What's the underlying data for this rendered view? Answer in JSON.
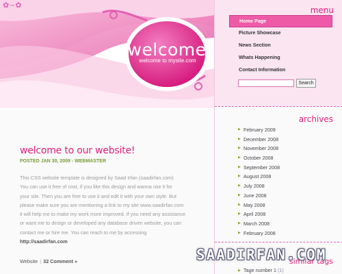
{
  "header": {
    "welcome_title": "welcome",
    "welcome_subtitle": "welcome to mysite.com"
  },
  "post": {
    "title": "welcome to our website!",
    "meta": "POSTED JAN 30, 2009 - WEBMASTER",
    "body_lines": [
      "This CSS website template is designed by Saad Irfan (saadirfan.com)",
      "You can use it free of cost, if you like this design and wanna use it for",
      "your site. Then you are free to use it and edit it with your own style. But",
      "please make sure you are mentioning a link to my site www.saadirfan.com",
      "it will help me to make my work more improved. If you need any assistance",
      "or want me to design or developed any database driven website, you can",
      "contact me or hire me. You can reach to me by accessing"
    ],
    "link": "http://saadirfan.com",
    "footer_category": "Website",
    "footer_separator": "|",
    "footer_comments": "32 Comment »"
  },
  "sidebar": {
    "menu_title": "menu",
    "menu_items": [
      {
        "label": "Home Page",
        "active": true
      },
      {
        "label": "Picture Showcase",
        "active": false
      },
      {
        "label": "News Section",
        "active": false
      },
      {
        "label": "Whats Happening",
        "active": false
      },
      {
        "label": "Contact Information",
        "active": false
      }
    ],
    "search": {
      "value": "",
      "button_label": "Search"
    },
    "archives_title": "archives",
    "archives": [
      "February 2009",
      "December 2008",
      "November 2008",
      "October 2008",
      "September 2008",
      "August 2008",
      "July 2008",
      "June 2008",
      "May 2008",
      "April 2008",
      "March 2008",
      "February 2008"
    ],
    "tags_title": "similar tags",
    "tags": [
      {
        "label": "Tage number 1",
        "count": "(1)"
      }
    ]
  },
  "watermark": "SAADIRFAN.COM",
  "colors": {
    "accent": "#e0207c",
    "menu_active": "#ee5aa6",
    "menu_bg": "#fbe5f1",
    "meta_green": "#7a9a34"
  },
  "icons": {
    "bullet": "triangle-bullet-icon"
  }
}
